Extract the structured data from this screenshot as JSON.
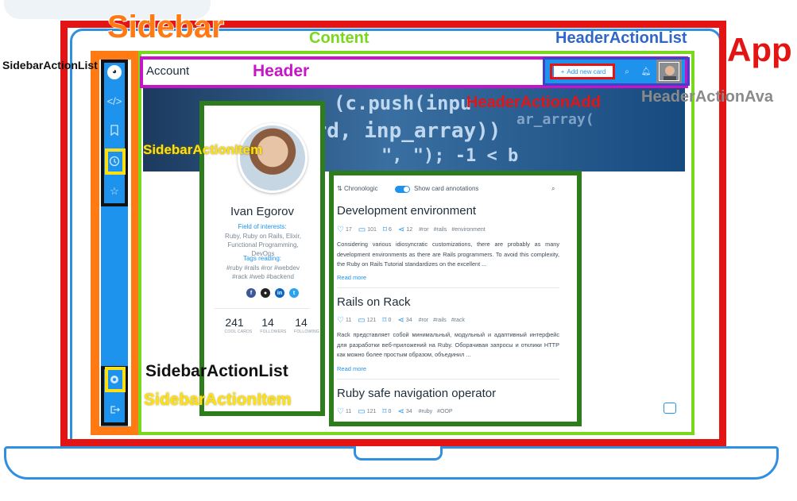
{
  "annotations": {
    "app": "App",
    "sidebar": "Sidebar",
    "content": "Content",
    "header": "Header",
    "header_action_list": "HeaderActionList",
    "header_action_add": "HeaderActionAdd",
    "header_action_avatar": "HeaderActionAva",
    "sidebar_action_list_top": "SidebarActionList",
    "sidebar_action_list_bottom": "SidebarActionList",
    "sidebar_action_item_top": "SidebarActionItem",
    "sidebar_action_item_bottom": "SidebarActionItem"
  },
  "colors": {
    "app": "#e41414",
    "sidebar": "#ff7a12",
    "content": "#79d81e",
    "header": "#c814c8",
    "header_action_list": "#4240c8",
    "action_list": "#111111",
    "action_item": "#ffe014",
    "components": "#2e7d1d",
    "brand_blue": "#1d93ee"
  },
  "sidebar": {
    "top_items": [
      "avatar-logo-icon",
      "code-icon",
      "bookmark-icon",
      "clock-icon",
      "star-icon"
    ],
    "bottom_items": [
      "settings-icon",
      "logout-icon"
    ]
  },
  "header": {
    "title": "Account",
    "add_button": "Add new card",
    "add_icon": "+",
    "icons": [
      "search-icon",
      "bell-icon",
      "avatar"
    ]
  },
  "cover": {
    "code_lines": [
      "(c.push(inpu",
      "ord, inp_array))",
      "\", \");  -1 < b",
      "ar_array("
    ]
  },
  "profile": {
    "name": "Ivan Egorov",
    "field_label": "Field of interests:",
    "fields": "Ruby, Ruby on Rails, Elixir, Functional Programming, DevOps",
    "tags_label": "Tags reading:",
    "tags": "#ruby #rails #ror #webdev #rack #web #backend",
    "social": [
      "f",
      "gh",
      "in",
      "tw"
    ],
    "stats": [
      {
        "value": "241",
        "label": "COOL CARDS"
      },
      {
        "value": "14",
        "label": "FOLLOWERS"
      },
      {
        "value": "14",
        "label": "FOLLOWING"
      }
    ]
  },
  "feed": {
    "sort_label": "Chronologic",
    "toggle_label": "Show card annotations",
    "read_more": "Read more",
    "posts": [
      {
        "title": "Development environment",
        "likes": "17",
        "comments": "101",
        "saves": "6",
        "shares": "12",
        "tags": [
          "#ror",
          "#rails",
          "#environment"
        ],
        "body": "Considering various idiosyncratic customizations, there are probably as many development environments as there are Rails programmers. To avoid this complexity, the Ruby on Rails Tutorial standardizes on the excellent ..."
      },
      {
        "title": "Rails on Rack",
        "likes": "11",
        "comments": "121",
        "saves": "0",
        "shares": "34",
        "tags": [
          "#ror",
          "#rails",
          "#rack"
        ],
        "body": "Rack представляет собой минимальный, модульный и адаптивный интерфейс для разработки веб-приложений на Ruby. Оборачивая запросы и отклики HTTP как можно более простым образом, объединил ..."
      },
      {
        "title": "Ruby safe navigation operator",
        "likes": "11",
        "comments": "121",
        "saves": "0",
        "shares": "34",
        "tags": [
          "#ruby",
          "#OOP"
        ],
        "body": ""
      }
    ]
  }
}
